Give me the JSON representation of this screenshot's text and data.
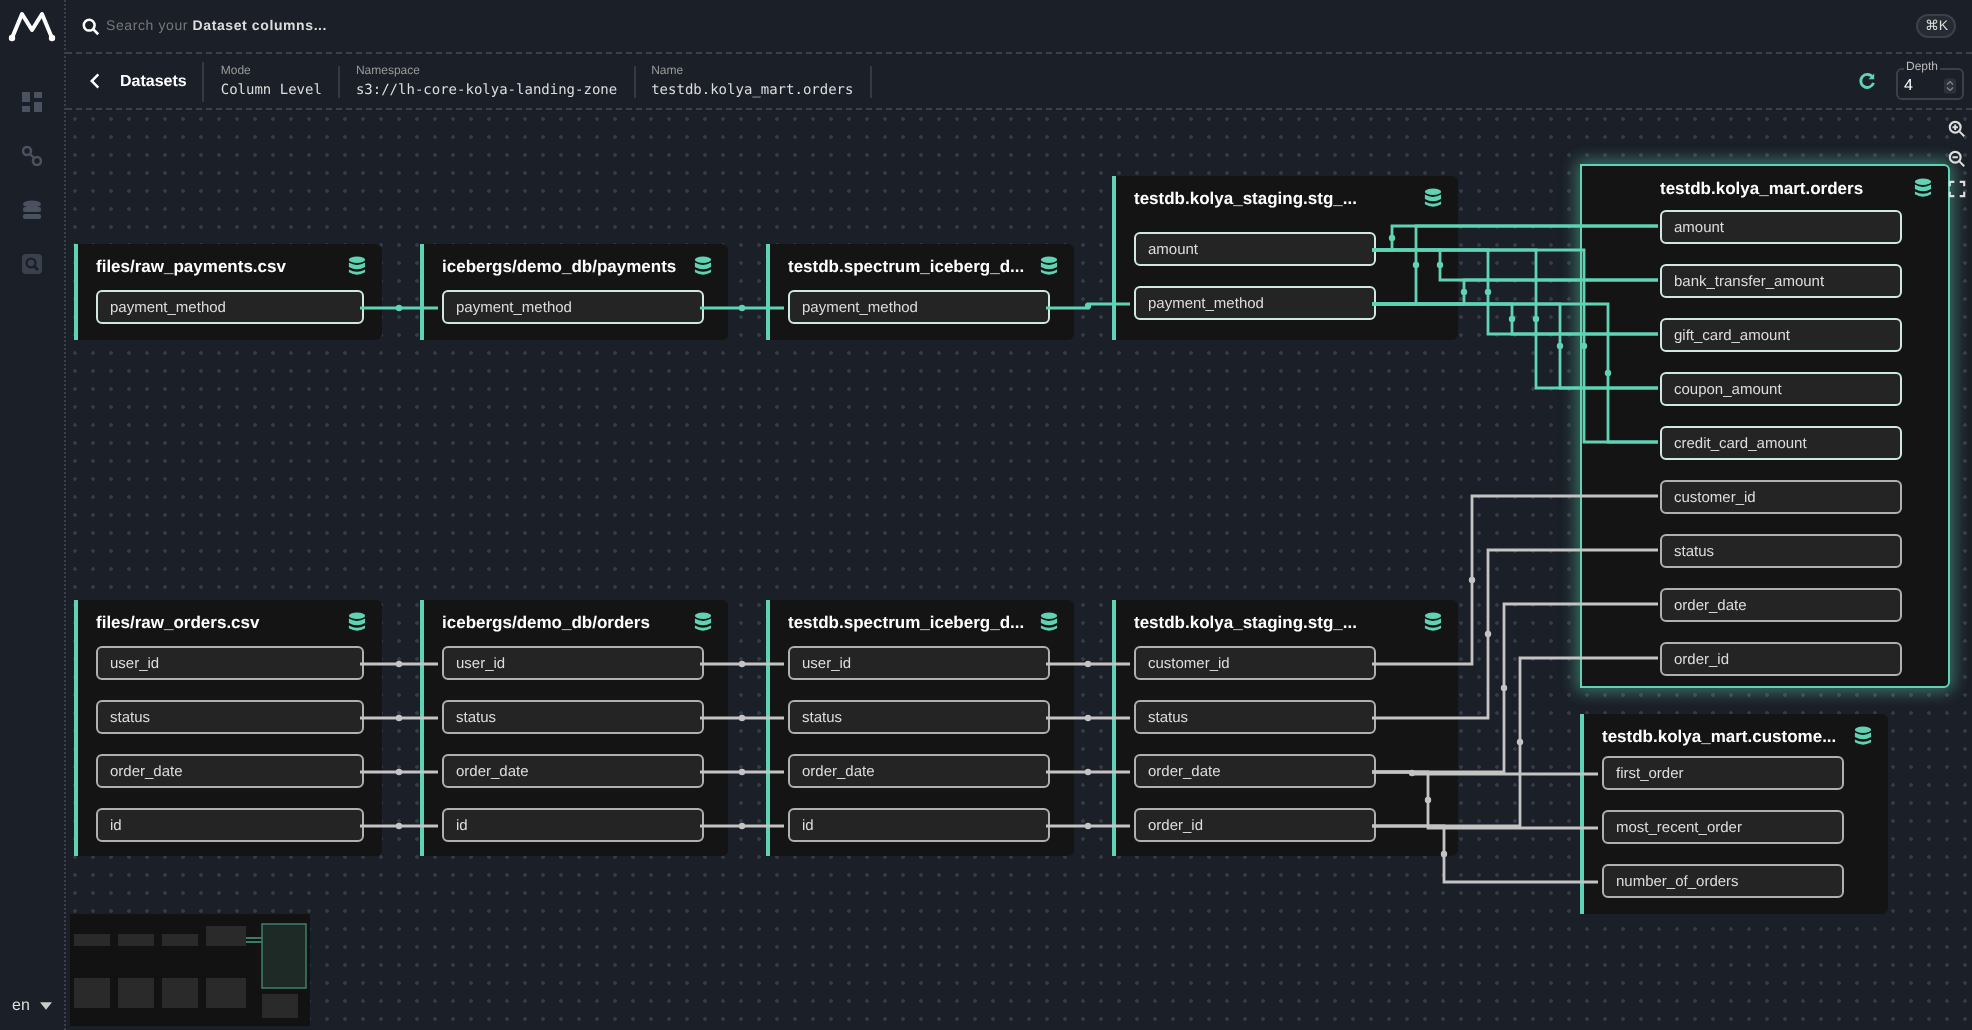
{
  "header": {
    "search": {
      "placeholder": "Search your **Dataset columns...**"
    },
    "shortcut": "⌘K"
  },
  "toolbar": {
    "back_label": "Datasets",
    "details": [
      {
        "label": "Mode",
        "value": "Column Level"
      },
      {
        "label": "Namespace",
        "value": "s3://lh-core-kolya-landing-zone"
      },
      {
        "label": "Name",
        "value": "testdb.kolya_mart.orders"
      }
    ],
    "depth": {
      "label": "Depth",
      "value": "4"
    }
  },
  "graph": {
    "nodes": [
      {
        "title": "files/raw_payments.csv",
        "selected": false,
        "fields": [
          {
            "name": "payment_method",
            "highlighted": true
          }
        ]
      },
      {
        "title": "icebergs/demo_db/payments",
        "selected": false,
        "fields": [
          {
            "name": "payment_method",
            "highlighted": true
          }
        ]
      },
      {
        "title": "testdb.spectrum_iceberg_d...",
        "selected": false,
        "fields": [
          {
            "name": "payment_method",
            "highlighted": true
          }
        ]
      },
      {
        "title": "testdb.kolya_staging.stg_...",
        "selected": false,
        "fields": [
          {
            "name": "amount",
            "highlighted": true
          },
          {
            "name": "payment_method",
            "highlighted": true
          }
        ]
      },
      {
        "title": "testdb.kolya_mart.orders",
        "selected": true,
        "fields": [
          {
            "name": "amount",
            "highlighted": true
          },
          {
            "name": "bank_transfer_amount",
            "highlighted": true
          },
          {
            "name": "gift_card_amount",
            "highlighted": true
          },
          {
            "name": "coupon_amount",
            "highlighted": true
          },
          {
            "name": "credit_card_amount",
            "highlighted": true
          },
          {
            "name": "customer_id",
            "highlighted": false
          },
          {
            "name": "status",
            "highlighted": false
          },
          {
            "name": "order_date",
            "highlighted": false
          },
          {
            "name": "order_id",
            "highlighted": false
          }
        ]
      },
      {
        "title": "files/raw_orders.csv",
        "selected": false,
        "fields": [
          {
            "name": "user_id",
            "highlighted": false
          },
          {
            "name": "status",
            "highlighted": false
          },
          {
            "name": "order_date",
            "highlighted": false
          },
          {
            "name": "id",
            "highlighted": false
          }
        ]
      },
      {
        "title": "icebergs/demo_db/orders",
        "selected": false,
        "fields": [
          {
            "name": "user_id",
            "highlighted": false
          },
          {
            "name": "status",
            "highlighted": false
          },
          {
            "name": "order_date",
            "highlighted": false
          },
          {
            "name": "id",
            "highlighted": false
          }
        ]
      },
      {
        "title": "testdb.spectrum_iceberg_d...",
        "selected": false,
        "fields": [
          {
            "name": "user_id",
            "highlighted": false
          },
          {
            "name": "status",
            "highlighted": false
          },
          {
            "name": "order_date",
            "highlighted": false
          },
          {
            "name": "id",
            "highlighted": false
          }
        ]
      },
      {
        "title": "testdb.kolya_staging.stg_...",
        "selected": false,
        "fields": [
          {
            "name": "customer_id",
            "highlighted": false
          },
          {
            "name": "status",
            "highlighted": false
          },
          {
            "name": "order_date",
            "highlighted": false
          },
          {
            "name": "order_id",
            "highlighted": false
          }
        ]
      },
      {
        "title": "testdb.kolya_mart.custome...",
        "selected": false,
        "fields": [
          {
            "name": "first_order",
            "highlighted": false
          },
          {
            "name": "most_recent_order",
            "highlighted": false
          },
          {
            "name": "number_of_orders",
            "highlighted": false
          }
        ]
      }
    ]
  },
  "language": "en"
}
